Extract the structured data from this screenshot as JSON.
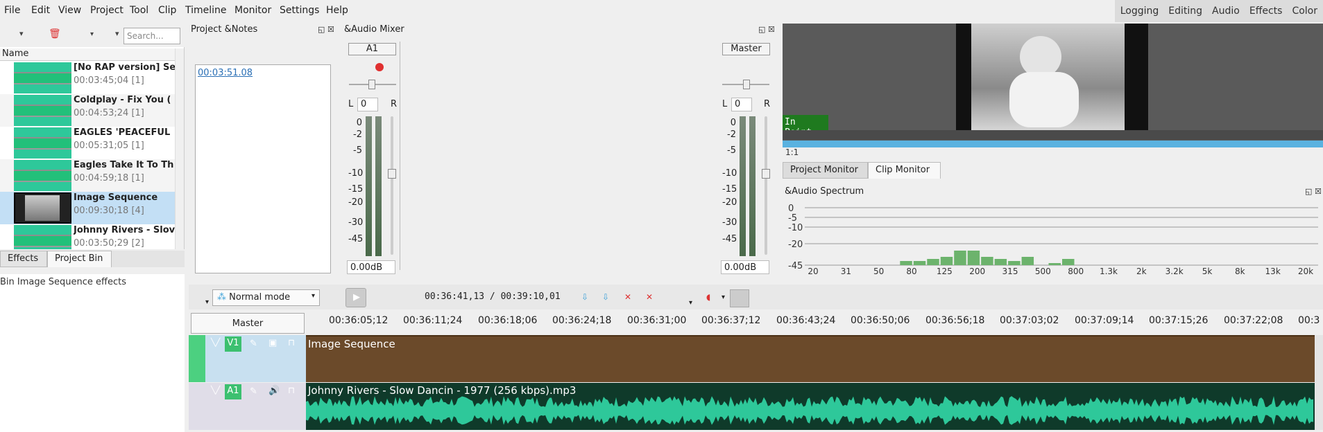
{
  "menu": [
    "File",
    "Edit",
    "View",
    "Project",
    "Tool",
    "Clip",
    "Timeline",
    "Monitor",
    "Settings",
    "Help"
  ],
  "layouts": [
    "Logging",
    "Editing",
    "Audio",
    "Effects",
    "Color"
  ],
  "bin": {
    "search_placeholder": "Search...",
    "header": "Name",
    "items": [
      {
        "title": "[No RAP version] Se",
        "sub": "00:03:45;04 [1]"
      },
      {
        "title": "Coldplay - Fix You (",
        "sub": "00:04:53;24 [1]"
      },
      {
        "title": "EAGLES 'PEACEFUL",
        "sub": "00:05:31;05 [1]"
      },
      {
        "title": "Eagles Take It To Th",
        "sub": "00:04:59;18 [1]"
      },
      {
        "title": "Image Sequence",
        "sub": "00:09:30;18 [4]"
      },
      {
        "title": "Johnny Rivers - Slov",
        "sub": "00:03:50;29 [2]"
      }
    ],
    "tabs": [
      "Effects",
      "Project Bin"
    ],
    "effects_label": "Bin Image Sequence effects"
  },
  "notes": {
    "title": "Project &Notes",
    "link": "00:03:51.08"
  },
  "mixer": {
    "title": "&Audio Mixer",
    "a1": "A1",
    "master": "Master",
    "scale": [
      "0",
      "-2",
      "-5",
      "-10",
      "-15",
      "-20",
      "-30",
      "-45"
    ],
    "db": "0.00dB",
    "l": "L",
    "r": "R",
    "spin": "0"
  },
  "monitor": {
    "in_point": "In Point",
    "zoom": "1:1",
    "tabs": [
      "Project Monitor",
      "Clip Monitor"
    ]
  },
  "spectrum": {
    "title": "&Audio Spectrum",
    "y_labels": [
      "0",
      "-5",
      "-10",
      "-20",
      "-45"
    ],
    "x_labels": [
      "20",
      "31",
      "50",
      "80",
      "125",
      "200",
      "315",
      "500",
      "800",
      "1.3k",
      "2k",
      "3.2k",
      "5k",
      "8k",
      "13k",
      "20k"
    ],
    "bars": [
      0,
      0,
      0,
      0,
      0,
      0,
      0,
      2,
      2,
      3,
      4,
      7,
      7,
      4,
      3,
      2,
      4,
      0,
      1,
      3,
      0,
      0,
      0,
      0,
      0,
      0,
      0,
      0,
      0,
      0,
      0,
      0,
      0,
      0,
      0,
      0,
      0,
      0
    ]
  },
  "timeline": {
    "mode": "Normal mode",
    "timecode": "00:36:41,13 / 00:39:10,01",
    "master": "Master",
    "ruler": [
      "00:36:05;12",
      "00:36:11;24",
      "00:36:18;06",
      "00:36:24;18",
      "00:36:31;00",
      "00:36:37;12",
      "00:36:43;24",
      "00:36:50;06",
      "00:36:56;18",
      "00:37:03;02",
      "00:37:09;14",
      "00:37:15;26",
      "00:37:22;08",
      "00:3"
    ],
    "v1": "V1",
    "a1": "A1",
    "v1_clip": "Image Sequence",
    "a1_clip": "Johnny Rivers - Slow Dancin - 1977 (256 kbps).mp3"
  }
}
